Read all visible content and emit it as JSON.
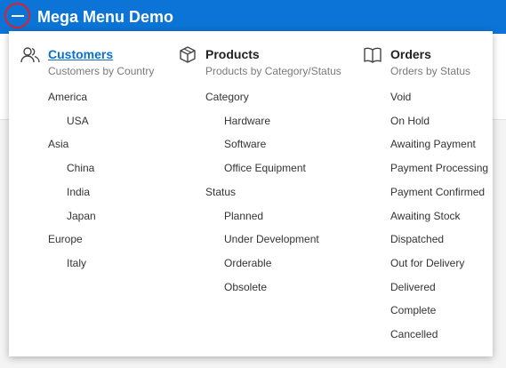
{
  "header": {
    "title": "Mega Menu Demo"
  },
  "columns": [
    {
      "heading": "Customers",
      "subtitle": "Customers by Country",
      "icon": "people-icon",
      "items": [
        {
          "label": "America",
          "level": 0
        },
        {
          "label": "USA",
          "level": 1
        },
        {
          "label": "Asia",
          "level": 0
        },
        {
          "label": "China",
          "level": 1
        },
        {
          "label": "India",
          "level": 1
        },
        {
          "label": "Japan",
          "level": 1
        },
        {
          "label": "Europe",
          "level": 0
        },
        {
          "label": "Italy",
          "level": 1
        }
      ]
    },
    {
      "heading": "Products",
      "subtitle": "Products by Category/Status",
      "icon": "box-icon",
      "items": [
        {
          "label": "Category",
          "level": 0
        },
        {
          "label": "Hardware",
          "level": 1
        },
        {
          "label": "Software",
          "level": 1
        },
        {
          "label": "Office Equipment",
          "level": 1
        },
        {
          "label": "Status",
          "level": 0
        },
        {
          "label": "Planned",
          "level": 1
        },
        {
          "label": "Under Development",
          "level": 1
        },
        {
          "label": "Orderable",
          "level": 1
        },
        {
          "label": "Obsolete",
          "level": 1
        }
      ]
    },
    {
      "heading": "Orders",
      "subtitle": "Orders by Status",
      "icon": "book-icon",
      "items": [
        {
          "label": "Void",
          "level": 0
        },
        {
          "label": "On Hold",
          "level": 0
        },
        {
          "label": "Awaiting Payment",
          "level": 0
        },
        {
          "label": "Payment Processing",
          "level": 0
        },
        {
          "label": "Payment Confirmed",
          "level": 0
        },
        {
          "label": "Awaiting Stock",
          "level": 0
        },
        {
          "label": "Dispatched",
          "level": 0
        },
        {
          "label": "Out for Delivery",
          "level": 0
        },
        {
          "label": "Delivered",
          "level": 0
        },
        {
          "label": "Complete",
          "level": 0
        },
        {
          "label": "Cancelled",
          "level": 0
        }
      ]
    }
  ],
  "colors": {
    "header_bg": "#0b74d6",
    "link": "#0b6fcc",
    "highlight": "#e0202a"
  }
}
